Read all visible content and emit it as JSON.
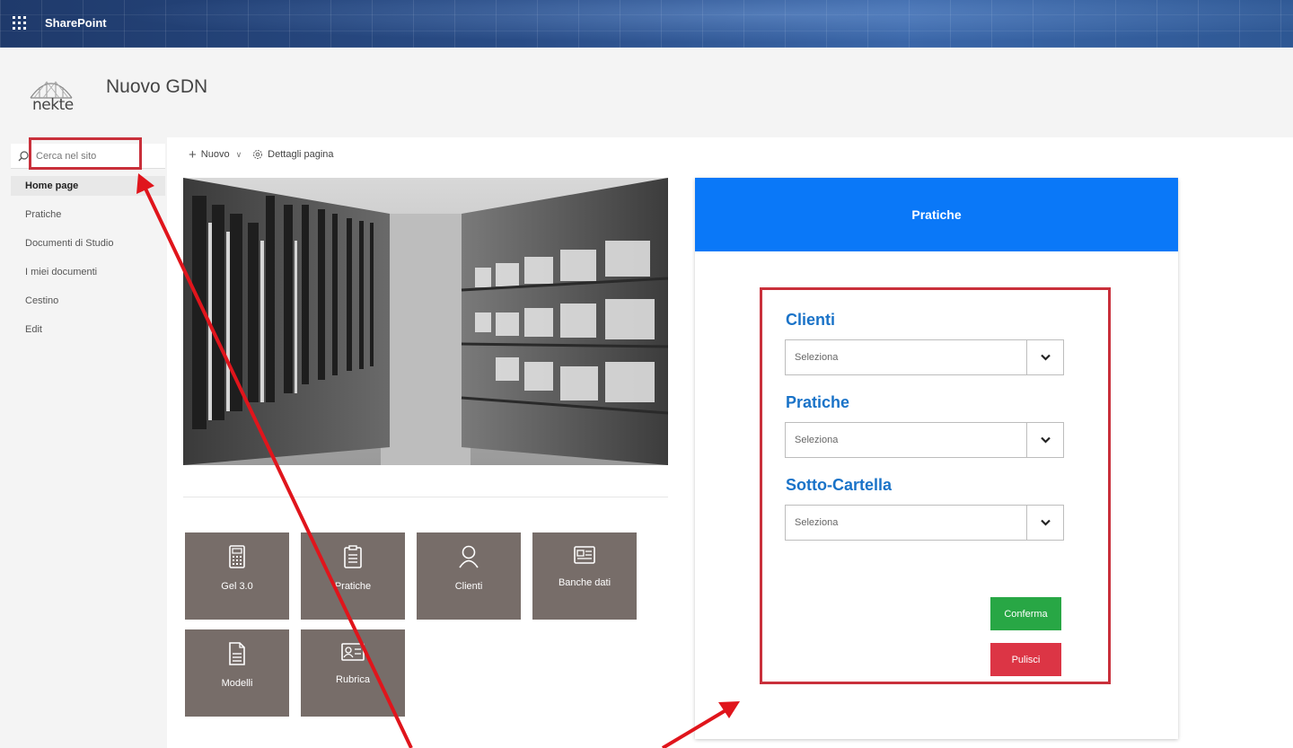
{
  "suitebar": {
    "brand": "SharePoint",
    "waffle_icon": "app-launcher-icon"
  },
  "site": {
    "logo_text": "nekte",
    "title": "Nuovo GDN"
  },
  "search": {
    "placeholder": "Cerca nel sito"
  },
  "nav": {
    "items": [
      {
        "label": "Home page",
        "active": true
      },
      {
        "label": "Pratiche"
      },
      {
        "label": "Documenti di Studio"
      },
      {
        "label": "I miei documenti"
      },
      {
        "label": "Cestino"
      },
      {
        "label": "Edit"
      }
    ]
  },
  "commandbar": {
    "new_label": "Nuovo",
    "details_label": "Dettagli pagina"
  },
  "tiles": [
    {
      "label": "Gel 3.0",
      "icon": "calculator-icon"
    },
    {
      "label": "Pratiche",
      "icon": "clipboard-icon"
    },
    {
      "label": "Clienti",
      "icon": "person-icon"
    },
    {
      "label": "Banche dati",
      "icon": "database-icon"
    },
    {
      "label": "Modelli",
      "icon": "document-icon"
    },
    {
      "label": "Rubrica",
      "icon": "contact-card-icon"
    }
  ],
  "card": {
    "title": "Pratiche",
    "fields": [
      {
        "label": "Clienti",
        "value": "Seleziona"
      },
      {
        "label": "Pratiche",
        "value": "Seleziona"
      },
      {
        "label": "Sotto-Cartella",
        "value": "Seleziona"
      }
    ],
    "confirm_label": "Conferma",
    "clear_label": "Pulisci"
  },
  "colors": {
    "card_header": "#0a78f8",
    "field_label": "#1a73c8",
    "confirm": "#28a745",
    "clear": "#dc3545",
    "highlight": "#c9303b",
    "tile": "#776d69"
  }
}
